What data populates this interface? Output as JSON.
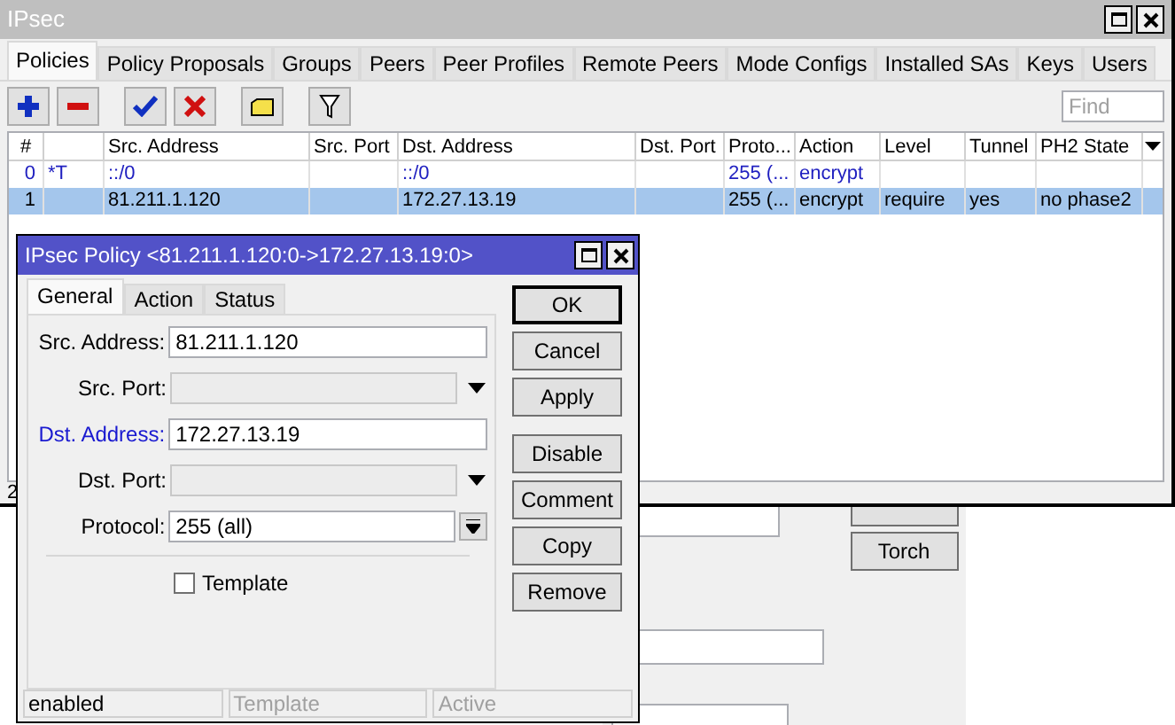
{
  "window": {
    "title": "IPsec"
  },
  "tabs": [
    {
      "label": "Policies",
      "selected": true
    },
    {
      "label": "Policy Proposals",
      "selected": false
    },
    {
      "label": "Groups",
      "selected": false
    },
    {
      "label": "Peers",
      "selected": false
    },
    {
      "label": "Peer Profiles",
      "selected": false
    },
    {
      "label": "Remote Peers",
      "selected": false
    },
    {
      "label": "Mode Configs",
      "selected": false
    },
    {
      "label": "Installed SAs",
      "selected": false
    },
    {
      "label": "Keys",
      "selected": false
    },
    {
      "label": "Users",
      "selected": false
    }
  ],
  "search": {
    "placeholder": "Find"
  },
  "table": {
    "columns": [
      "#",
      "",
      "Src. Address",
      "Src. Port",
      "Dst. Address",
      "Dst. Port",
      "Proto...",
      "Action",
      "Level",
      "Tunnel",
      "PH2 State"
    ],
    "rows": [
      {
        "cells": [
          "0",
          "*T",
          "::/0",
          "",
          "::/0",
          "",
          "255 (...",
          "encrypt",
          "",
          "",
          ""
        ],
        "template": true,
        "selected": false
      },
      {
        "cells": [
          "1",
          "",
          "81.211.1.120",
          "",
          "172.27.13.19",
          "",
          "255 (...",
          "encrypt",
          "require",
          "yes",
          "no phase2"
        ],
        "template": false,
        "selected": true
      }
    ]
  },
  "status_bar": "2",
  "background_window": {
    "buttons": [
      "Torch"
    ]
  },
  "dialog": {
    "title": "IPsec Policy <81.211.1.120:0->172.27.13.19:0>",
    "tabs": [
      {
        "label": "General",
        "selected": true
      },
      {
        "label": "Action",
        "selected": false
      },
      {
        "label": "Status",
        "selected": false
      }
    ],
    "fields": [
      {
        "label": "Src. Address:",
        "kind": "text",
        "value": "81.211.1.120",
        "highlighted": false
      },
      {
        "label": "Src. Port:",
        "kind": "dropdown",
        "highlighted": false
      },
      {
        "label": "Dst. Address:",
        "kind": "text",
        "value": "172.27.13.19",
        "highlighted": true
      },
      {
        "label": "Dst. Port:",
        "kind": "dropdown",
        "highlighted": false
      },
      {
        "label": "Protocol:",
        "kind": "combo",
        "value": "255 (all)",
        "highlighted": false
      }
    ],
    "checkbox": {
      "label": "Template",
      "checked": false
    },
    "button_groups": [
      [
        {
          "label": "OK",
          "default": true
        },
        {
          "label": "Cancel",
          "default": false
        },
        {
          "label": "Apply",
          "default": false
        }
      ],
      [
        {
          "label": "Disable",
          "default": false
        },
        {
          "label": "Comment",
          "default": false
        },
        {
          "label": "Copy",
          "default": false
        },
        {
          "label": "Remove",
          "default": false
        }
      ]
    ],
    "status": [
      {
        "text": "enabled",
        "disabled": false
      },
      {
        "text": "Template",
        "disabled": true
      },
      {
        "text": "Active",
        "disabled": true
      }
    ]
  }
}
